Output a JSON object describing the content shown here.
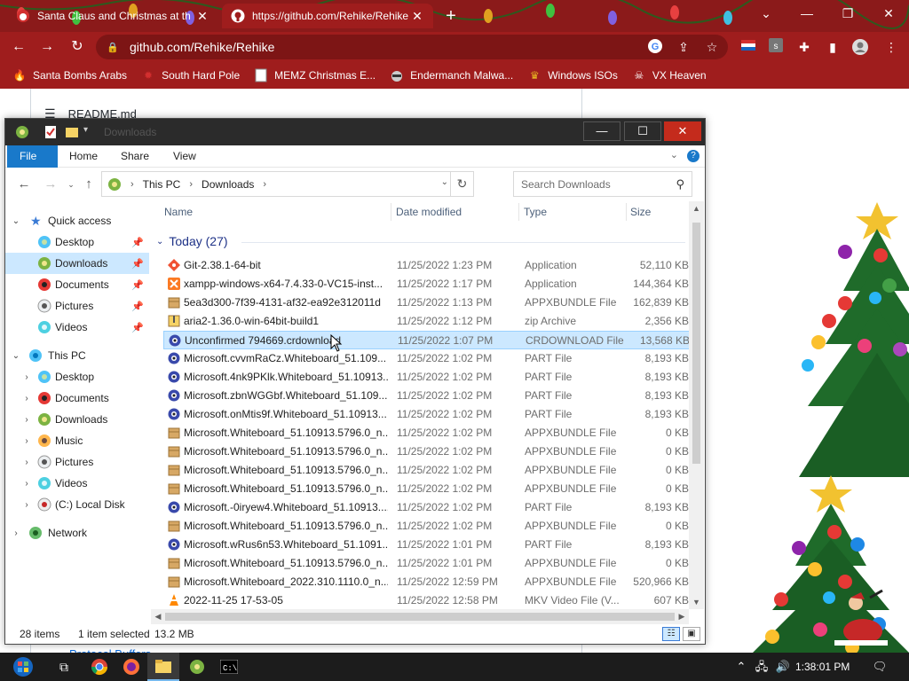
{
  "browser": {
    "tabs": [
      {
        "title": "Santa Claus and Christmas at th",
        "active": false
      },
      {
        "title": "https://github.com/Rehike/Rehike",
        "active": true
      }
    ],
    "new_tab": "+",
    "url": "github.com/Rehike/Rehike",
    "bookmarks": [
      {
        "label": "Santa Bombs Arabs",
        "icon": "fire-icon"
      },
      {
        "label": "South Hard Pole",
        "icon": "maple-leaf-icon"
      },
      {
        "label": "MEMZ Christmas E...",
        "icon": "page-icon"
      },
      {
        "label": "Endermanch Malwa...",
        "icon": "raccoon-icon"
      },
      {
        "label": "Windows ISOs",
        "icon": "trophy-icon"
      },
      {
        "label": "VX Heaven",
        "icon": "skull-icon"
      }
    ],
    "colors": {
      "frame": "#9f1d1d",
      "frame_dark": "#8b1a1a"
    }
  },
  "page": {
    "readme": "README.md",
    "protocol_link": "Protocol Buffers"
  },
  "explorer": {
    "title": "Downloads",
    "ribbon_tabs": [
      "File",
      "Home",
      "Share",
      "View"
    ],
    "breadcrumb": [
      "This PC",
      "Downloads"
    ],
    "search_placeholder": "Search Downloads",
    "nav": {
      "quick_access": "Quick access",
      "quick_items": [
        "Desktop",
        "Downloads",
        "Documents",
        "Pictures",
        "Videos"
      ],
      "this_pc": "This PC",
      "pc_items": [
        "Desktop",
        "Documents",
        "Downloads",
        "Music",
        "Pictures",
        "Videos",
        "(C:) Local Disk"
      ],
      "network": "Network"
    },
    "columns": {
      "name": "Name",
      "date": "Date modified",
      "type": "Type",
      "size": "Size"
    },
    "group_label": "Today (27)",
    "files": [
      {
        "name": "Git-2.38.1-64-bit",
        "date": "11/25/2022 1:23 PM",
        "type": "Application",
        "size": "52,110 KB",
        "icon": "git-icon"
      },
      {
        "name": "xampp-windows-x64-7.4.33-0-VC15-inst...",
        "date": "11/25/2022 1:17 PM",
        "type": "Application",
        "size": "144,364 KB",
        "icon": "xampp-icon"
      },
      {
        "name": "5ea3d300-7f39-4131-af32-ea92e312011d",
        "date": "11/25/2022 1:13 PM",
        "type": "APPXBUNDLE File",
        "size": "162,839 KB",
        "icon": "package-icon"
      },
      {
        "name": "aria2-1.36.0-win-64bit-build1",
        "date": "11/25/2022 1:12 PM",
        "type": "zip Archive",
        "size": "2,356 KB",
        "icon": "zip-icon"
      },
      {
        "name": "Unconfirmed 794669.crdownload",
        "date": "11/25/2022 1:07 PM",
        "type": "CRDOWNLOAD File",
        "size": "13,568 KB",
        "icon": "generic-file-icon"
      },
      {
        "name": "Microsoft.cvvmRaCz.Whiteboard_51.109...",
        "date": "11/25/2022 1:02 PM",
        "type": "PART File",
        "size": "8,193 KB",
        "icon": "generic-file-icon"
      },
      {
        "name": "Microsoft.4nk9PKlk.Whiteboard_51.10913...",
        "date": "11/25/2022 1:02 PM",
        "type": "PART File",
        "size": "8,193 KB",
        "icon": "generic-file-icon"
      },
      {
        "name": "Microsoft.zbnWGGbf.Whiteboard_51.109...",
        "date": "11/25/2022 1:02 PM",
        "type": "PART File",
        "size": "8,193 KB",
        "icon": "generic-file-icon"
      },
      {
        "name": "Microsoft.onMtis9f.Whiteboard_51.10913...",
        "date": "11/25/2022 1:02 PM",
        "type": "PART File",
        "size": "8,193 KB",
        "icon": "generic-file-icon"
      },
      {
        "name": "Microsoft.Whiteboard_51.10913.5796.0_n...",
        "date": "11/25/2022 1:02 PM",
        "type": "APPXBUNDLE File",
        "size": "0 KB",
        "icon": "package-icon"
      },
      {
        "name": "Microsoft.Whiteboard_51.10913.5796.0_n...",
        "date": "11/25/2022 1:02 PM",
        "type": "APPXBUNDLE File",
        "size": "0 KB",
        "icon": "package-icon"
      },
      {
        "name": "Microsoft.Whiteboard_51.10913.5796.0_n...",
        "date": "11/25/2022 1:02 PM",
        "type": "APPXBUNDLE File",
        "size": "0 KB",
        "icon": "package-icon"
      },
      {
        "name": "Microsoft.Whiteboard_51.10913.5796.0_n...",
        "date": "11/25/2022 1:02 PM",
        "type": "APPXBUNDLE File",
        "size": "0 KB",
        "icon": "package-icon"
      },
      {
        "name": "Microsoft.-0iryew4.Whiteboard_51.10913....",
        "date": "11/25/2022 1:02 PM",
        "type": "PART File",
        "size": "8,193 KB",
        "icon": "generic-file-icon"
      },
      {
        "name": "Microsoft.Whiteboard_51.10913.5796.0_n...",
        "date": "11/25/2022 1:02 PM",
        "type": "APPXBUNDLE File",
        "size": "0 KB",
        "icon": "package-icon"
      },
      {
        "name": "Microsoft.wRus6n53.Whiteboard_51.1091...",
        "date": "11/25/2022 1:01 PM",
        "type": "PART File",
        "size": "8,193 KB",
        "icon": "generic-file-icon"
      },
      {
        "name": "Microsoft.Whiteboard_51.10913.5796.0_n...",
        "date": "11/25/2022 1:01 PM",
        "type": "APPXBUNDLE File",
        "size": "0 KB",
        "icon": "package-icon"
      },
      {
        "name": "Microsoft.Whiteboard_2022.310.1110.0_n...",
        "date": "11/25/2022 12:59 PM",
        "type": "APPXBUNDLE File",
        "size": "520,966 KB",
        "icon": "package-icon"
      },
      {
        "name": "2022-11-25 17-53-05",
        "date": "11/25/2022 12:58 PM",
        "type": "MKV Video File (V...",
        "size": "607 KB",
        "icon": "vlc-cone-icon"
      }
    ],
    "selected_index": 4,
    "status": {
      "count": "28 items",
      "selection": "1 item selected",
      "size": "13.2 MB"
    }
  },
  "taskbar": {
    "clock": "1:38:01 PM"
  }
}
